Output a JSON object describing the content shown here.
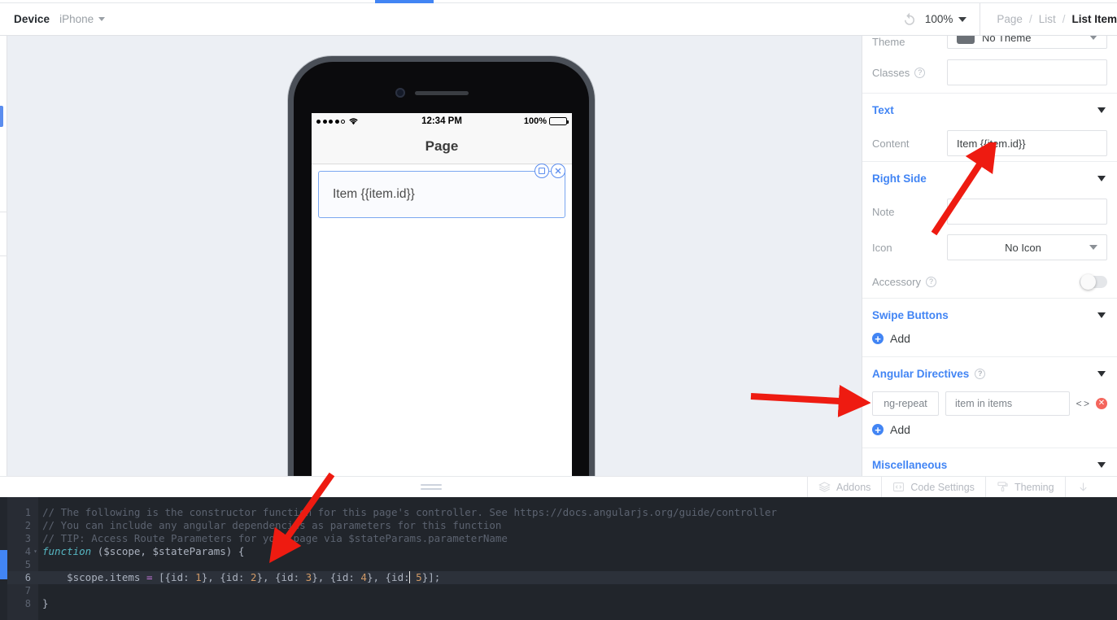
{
  "topbar": {
    "device_label": "Device",
    "device_value": "iPhone",
    "rotate_icon": "rotate-icon",
    "zoom_value": "100%",
    "caret_icon": "chevron-down-icon"
  },
  "breadcrumb": {
    "items": [
      {
        "label": "Page",
        "active": false
      },
      {
        "label": "List",
        "active": false
      },
      {
        "label": "List Item",
        "active": true
      }
    ],
    "separator": "/"
  },
  "preview": {
    "status_bar": {
      "time": "12:34 PM",
      "battery_percent": "100%",
      "signal_icon": "signal-dots-icon",
      "wifi_icon": "wifi-icon",
      "battery_icon": "battery-full-icon"
    },
    "nav_title": "Page",
    "list_item_text": "Item {{item.id}}",
    "handles": {
      "duplicate_icon": "duplicate-icon",
      "close_icon": "close-icon"
    },
    "grip_icon": "drag-handle-icon"
  },
  "sidebar": {
    "theme": {
      "label": "Theme",
      "value": "No Theme",
      "swatch_color": "#6b7076"
    },
    "classes": {
      "label": "Classes",
      "value": "",
      "help_icon": "help-icon"
    },
    "sections": {
      "text": {
        "title": "Text",
        "content_label": "Content",
        "content_value": "Item {{item.id}}",
        "collapse_icon": "chevron-down-icon"
      },
      "right_side": {
        "title": "Right Side",
        "note_label": "Note",
        "note_value": "",
        "icon_label": "Icon",
        "icon_value": "No Icon",
        "accessory_label": "Accessory",
        "accessory_on": false,
        "help_icon": "help-icon",
        "collapse_icon": "chevron-down-icon"
      },
      "swipe_buttons": {
        "title": "Swipe Buttons",
        "add_label": "Add",
        "add_icon": "plus-circle-icon",
        "collapse_icon": "chevron-down-icon"
      },
      "angular_directives": {
        "title": "Angular Directives",
        "help_icon": "help-icon",
        "collapse_icon": "chevron-down-icon",
        "rows": [
          {
            "key": "ng-repeat",
            "value": "item in items",
            "code_icon": "code-brackets-icon",
            "delete_icon": "delete-circle-icon"
          }
        ],
        "add_label": "Add",
        "add_icon": "plus-circle-icon"
      },
      "miscellaneous": {
        "title": "Miscellaneous",
        "collapse_icon": "chevron-down-icon"
      }
    }
  },
  "bottombar": {
    "buttons": [
      {
        "label": "Addons",
        "icon": "layers-icon"
      },
      {
        "label": "Code Settings",
        "icon": "code-brackets-icon"
      },
      {
        "label": "Theming",
        "icon": "paint-roller-icon"
      }
    ],
    "collapse_icon": "arrow-down-icon"
  },
  "editor": {
    "line_numbers": [
      "1",
      "2",
      "3",
      "4",
      "5",
      "6",
      "7",
      "8"
    ],
    "active_line": 6,
    "lines": [
      {
        "n": 1,
        "text": "// The following is the constructor function for this page's controller. See https://docs.angularjs.org/guide/controller"
      },
      {
        "n": 2,
        "text": "// You can include any angular dependencies as parameters for this function"
      },
      {
        "n": 3,
        "text": "// TIP: Access Route Parameters for your page via $stateParams.parameterName"
      },
      {
        "n": 4,
        "text": "function ($scope, $stateParams) {"
      },
      {
        "n": 5,
        "text": ""
      },
      {
        "n": 6,
        "text": "    $scope.items = [{id: 1}, {id: 2}, {id: 3}, {id: 4}, {id: 5}];"
      },
      {
        "n": 7,
        "text": ""
      },
      {
        "n": 8,
        "text": "}"
      }
    ]
  },
  "colors": {
    "accent": "#4285f4",
    "annotation": "#ee1b11",
    "editor_bg": "#21252b",
    "canvas_bg": "#eceff4"
  }
}
